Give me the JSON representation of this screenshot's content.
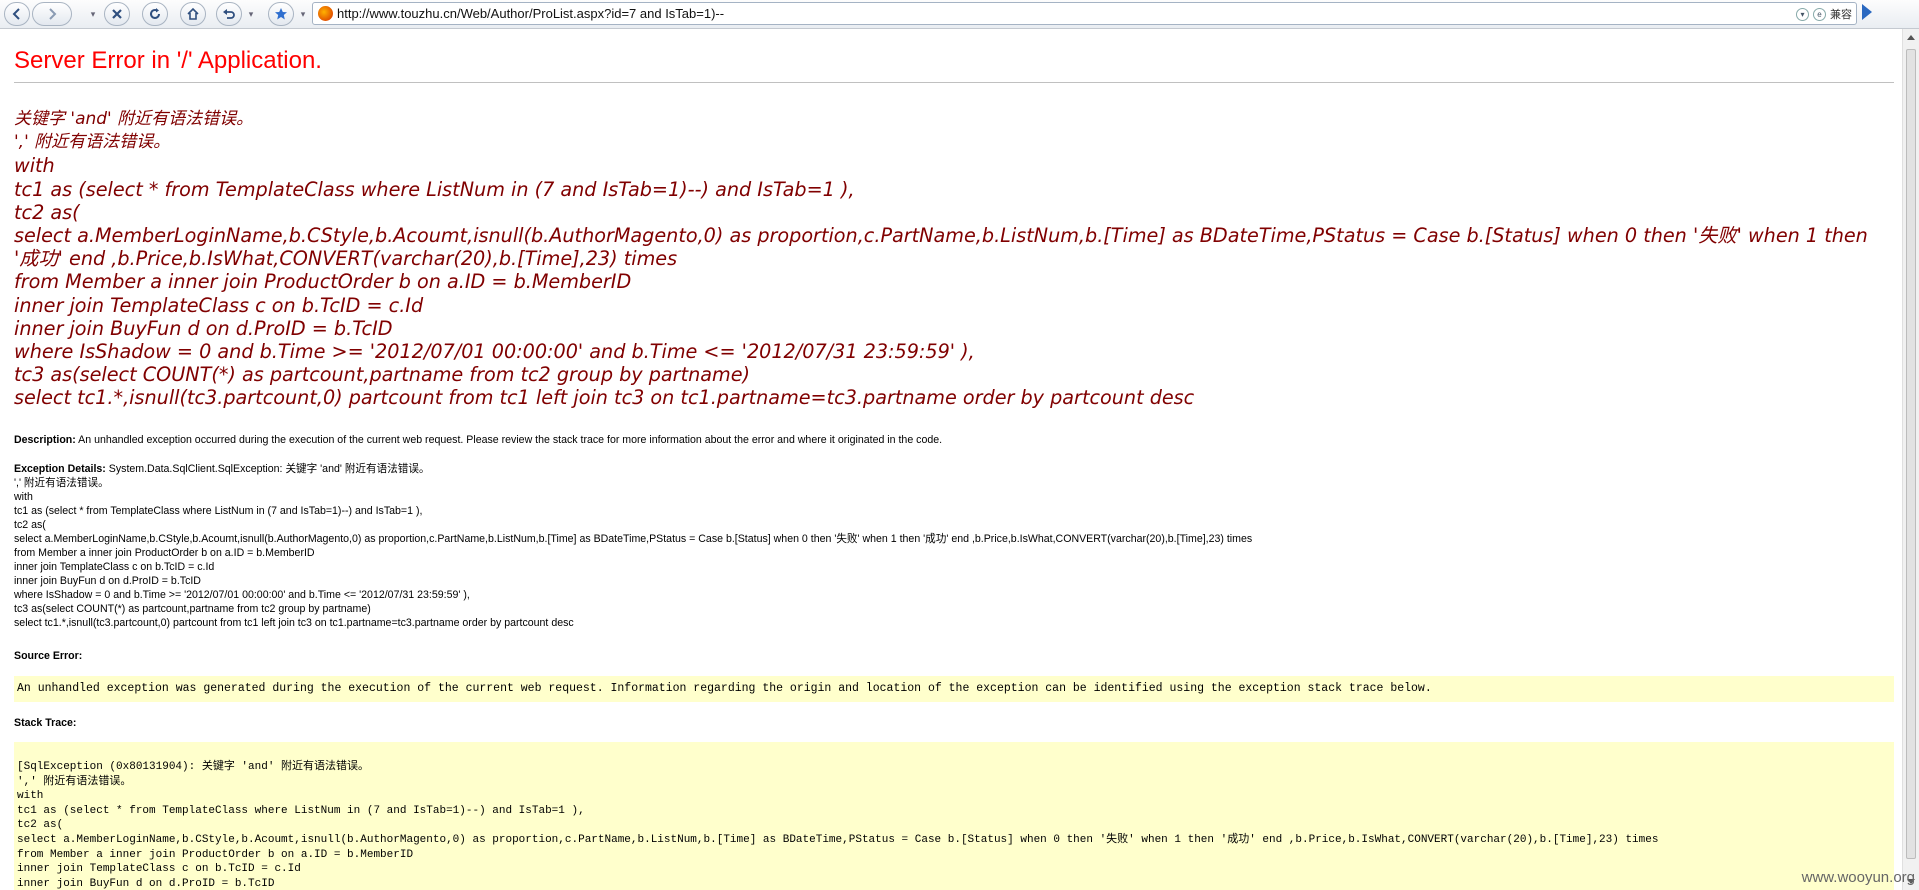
{
  "browser": {
    "url": "http://www.touzhu.cn/Web/Author/ProList.aspx?id=7 and IsTab=1)--",
    "compat_label": "兼容",
    "icons": [
      "back-icon",
      "forward-icon",
      "stop-icon",
      "refresh-icon",
      "home-icon",
      "undo-icon",
      "favorite-icon",
      "go-icon"
    ]
  },
  "page": {
    "title": "Server Error in '/' Application.",
    "error_lines": [
      "关键字 'and' 附近有语法错误。",
      "',' 附近有语法错误。",
      "with",
      "tc1 as (select * from TemplateClass where ListNum in (7 and IsTab=1)--) and IsTab=1 ),",
      "tc2 as(",
      "select a.MemberLoginName,b.CStyle,b.Acoumt,isnull(b.AuthorMagento,0) as proportion,c.PartName,b.ListNum,b.[Time] as BDateTime,PStatus = Case b.[Status] when 0 then '失败' when 1 then '成功' end ,b.Price,b.IsWhat,CONVERT(varchar(20),b.[Time],23) times",
      "from Member a inner join ProductOrder b on a.ID = b.MemberID",
      "inner join TemplateClass c on b.TcID = c.Id",
      "inner join BuyFun d on d.ProID = b.TcID",
      "where IsShadow = 0 and b.Time >= '2012/07/01 00:00:00' and b.Time <= '2012/07/31 23:59:59' ),",
      "tc3 as(select COUNT(*) as partcount,partname from tc2 group by partname)",
      "select tc1.*,isnull(tc3.partcount,0) partcount from tc1 left join tc3 on tc1.partname=tc3.partname order by partcount desc"
    ],
    "description_label": "Description:",
    "description_text": "An unhandled exception occurred during the execution of the current web request. Please review the stack trace for more information about the error and where it originated in the code.",
    "exception_label": "Exception Details:",
    "exception_first": "System.Data.SqlClient.SqlException: 关键字 'and' 附近有语法错误。",
    "exception_lines": [
      "',' 附近有语法错误。",
      "with",
      "tc1 as (select * from TemplateClass where ListNum in (7 and IsTab=1)--) and IsTab=1 ),",
      "tc2 as(",
      "select a.MemberLoginName,b.CStyle,b.Acoumt,isnull(b.AuthorMagento,0) as proportion,c.PartName,b.ListNum,b.[Time] as BDateTime,PStatus = Case b.[Status] when 0 then '失败' when 1 then '成功' end ,b.Price,b.IsWhat,CONVERT(varchar(20),b.[Time],23) times",
      " from Member a inner join ProductOrder b on a.ID = b.MemberID",
      " inner join TemplateClass c on b.TcID = c.Id",
      " inner join BuyFun d on d.ProID = b.TcID",
      " where IsShadow = 0 and b.Time >= '2012/07/01 00:00:00' and b.Time <= '2012/07/31 23:59:59' ),",
      " tc3 as(select COUNT(*) as partcount,partname from tc2 group by partname)",
      " select tc1.*,isnull(tc3.partcount,0) partcount from tc1 left join tc3 on tc1.partname=tc3.partname order by partcount desc"
    ],
    "source_error_label": "Source Error:",
    "source_error_text": "An unhandled exception was generated during the execution of the current web request. Information regarding the origin and location of the exception can be identified using the exception stack trace below.",
    "stack_trace_label": "Stack Trace:",
    "stack_lines": [
      "[SqlException (0x80131904): 关键字 'and' 附近有语法错误。",
      "',' 附近有语法错误。",
      "with",
      "tc1 as (select * from TemplateClass where ListNum in (7 and IsTab=1)--) and IsTab=1 ),",
      "tc2 as(",
      " select a.MemberLoginName,b.CStyle,b.Acoumt,isnull(b.AuthorMagento,0) as proportion,c.PartName,b.ListNum,b.[Time] as BDateTime,PStatus = Case b.[Status] when 0 then '失败' when 1 then '成功' end ,b.Price,b.IsWhat,CONVERT(varchar(20),b.[Time],23) times",
      " from Member a inner join ProductOrder b on a.ID = b.MemberID",
      " inner join TemplateClass c on b.TcID = c.Id",
      " inner join BuyFun d on d.ProID = b.TcID"
    ],
    "watermark": "www.wooyun.org"
  }
}
